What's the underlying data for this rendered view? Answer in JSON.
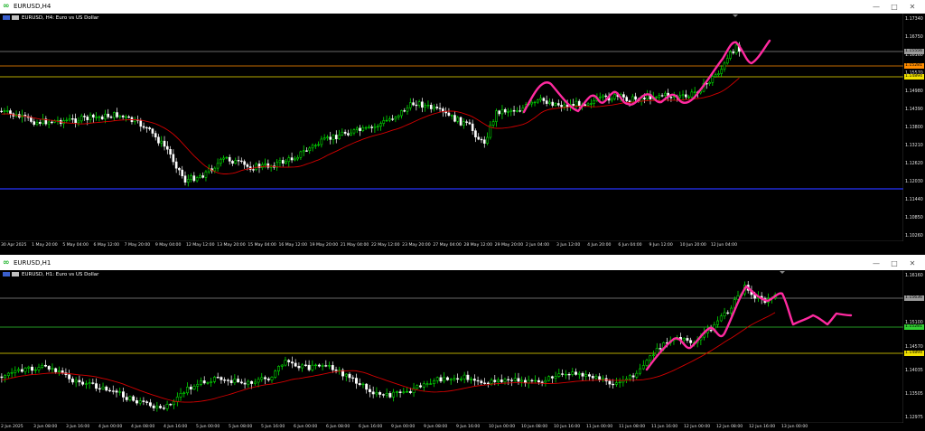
{
  "top_window": {
    "title": "EURUSD,H4",
    "symbol_label": "EURUSD, H4:  Euro vs US Dollar",
    "y_labels": [
      "1.17340",
      "1.16750",
      "1.16160",
      "1.15570",
      "1.14980",
      "1.14390",
      "1.13800",
      "1.13210",
      "1.12620",
      "1.12030",
      "1.11440",
      "1.10850",
      "1.10260"
    ],
    "price_tags": [
      "1.15556",
      "1.15281",
      "1.14894"
    ],
    "x_labels": [
      "30 Apr 2025",
      "1 May 20:00",
      "5 May 04:00",
      "6 May 12:00",
      "7 May 20:00",
      "9 May 04:00",
      "12 May 12:00",
      "13 May 20:00",
      "15 May 04:00",
      "16 May 12:00",
      "19 May 20:00",
      "21 May 04:00",
      "22 May 12:00",
      "23 May 20:00",
      "27 May 04:00",
      "28 May 12:00",
      "29 May 20:00",
      "2 Jun 04:00",
      "3 Jun 12:00",
      "4 Jun 20:00",
      "6 Jun 04:00",
      "9 Jun 12:00",
      "10 Jun 20:00",
      "12 Jun 04:00"
    ]
  },
  "bottom_window": {
    "title": "EURUSD,H1",
    "symbol_label": "EURUSD, H1:  Euro vs US Dollar",
    "y_labels": [
      "1.16160",
      "1.15630",
      "1.15100",
      "1.14570",
      "1.14035",
      "1.13505",
      "1.12975"
    ],
    "price_tags": [
      "1.15636",
      "1.15281",
      "1.14894"
    ],
    "x_labels": [
      "2 Jun 2025",
      "3 Jun 08:00",
      "3 Jun 16:00",
      "4 Jun 00:00",
      "4 Jun 08:00",
      "4 Jun 16:00",
      "5 Jun 00:00",
      "5 Jun 08:00",
      "5 Jun 16:00",
      "6 Jun 00:00",
      "6 Jun 08:00",
      "6 Jun 16:00",
      "9 Jun 00:00",
      "9 Jun 08:00",
      "9 Jun 16:00",
      "10 Jun 00:00",
      "10 Jun 08:00",
      "10 Jun 16:00",
      "11 Jun 00:00",
      "11 Jun 08:00",
      "11 Jun 16:00",
      "12 Jun 00:00",
      "12 Jun 08:00",
      "12 Jun 16:00",
      "13 Jun 00:00"
    ]
  },
  "colors": {
    "bull": "#00ff00",
    "bear": "#ffffff",
    "ma": "#d40000",
    "drawing": "#ff2aa0",
    "level_grey": "#8a8a8a",
    "level_orange": "#ff8c00",
    "level_yellow": "#f0e000",
    "level_blue": "#1f2bd6",
    "level_green": "#32cd32"
  },
  "window_controls": [
    "minimize-icon",
    "maximize-icon",
    "close-icon"
  ]
}
